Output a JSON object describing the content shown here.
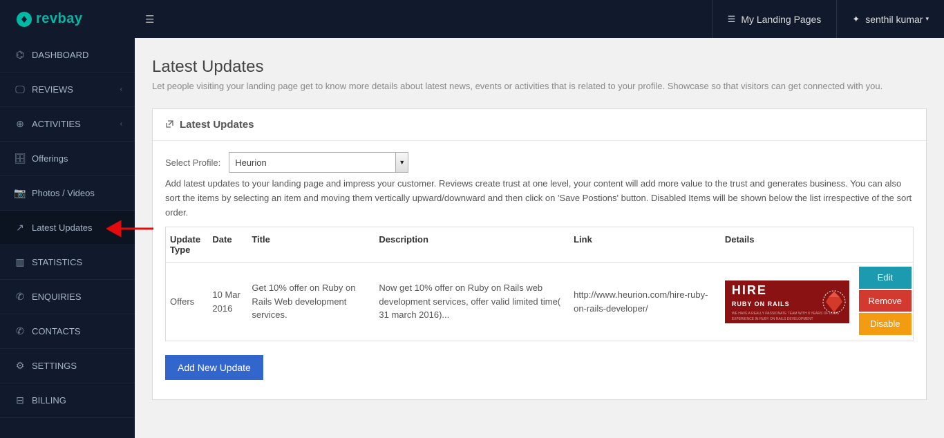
{
  "header": {
    "brand": "revbay",
    "my_landing": "My Landing Pages",
    "user": "senthil kumar"
  },
  "sidebar": [
    {
      "label": "DASHBOARD",
      "icon": "dash",
      "upper": true
    },
    {
      "label": "REVIEWS",
      "icon": "display",
      "upper": true,
      "chevron": true
    },
    {
      "label": "ACTIVITIES",
      "icon": "globe",
      "upper": true,
      "chevron": true
    },
    {
      "label": "Offerings",
      "icon": "case"
    },
    {
      "label": "Photos / Videos",
      "icon": "camera"
    },
    {
      "label": "Latest Updates",
      "icon": "ext",
      "active": true
    },
    {
      "label": "STATISTICS",
      "icon": "chart",
      "upper": true
    },
    {
      "label": "ENQUIRIES",
      "icon": "phone",
      "upper": true
    },
    {
      "label": "CONTACTS",
      "icon": "phone",
      "upper": true
    },
    {
      "label": "SETTINGS",
      "icon": "gear",
      "upper": true
    },
    {
      "label": "BILLING",
      "icon": "billing",
      "upper": true
    }
  ],
  "page": {
    "title": "Latest Updates",
    "subtitle": "Let people visiting your landing page get to know more details about latest news, events or activities that is related to your profile. Showcase so that visitors can get connected with you.",
    "card_title": "Latest Updates",
    "select_label": "Select Profile:",
    "select_value": "Heurion",
    "help_text": "Add latest updates to your landing page and impress your customer. Reviews create trust at one level, your content will add more value to the trust and generates business. You can also sort the items by selecting an item and moving them vertically upward/downward and then click on 'Save Postions' button. Disabled Items will be shown below the list irrespective of the sort order.",
    "add_btn": "Add New Update"
  },
  "table": {
    "headers": [
      "Update Type",
      "Date",
      "Title",
      "Description",
      "Link",
      "Details",
      ""
    ],
    "row": {
      "type": "Offers",
      "date": "10 Mar 2016",
      "title": "Get 10% offer on Ruby on Rails Web development services.",
      "desc": "Now get 10% offer on Ruby on Rails web development services, offer valid limited time( 31 march 2016)...",
      "link": "http://www.heurion.com/hire-ruby-on-rails-developer/",
      "banner_line1": "HIRE",
      "banner_line2": "RUBY ON RAILS",
      "banner_line3": "WE HAVE A REALLY PASSIONATE TEAM WITH 8 YEARS OF LONG EXPERIENCE IN RUBY ON RAILS DEVELOPMENT"
    },
    "actions": {
      "edit": "Edit",
      "remove": "Remove",
      "disable": "Disable"
    }
  }
}
